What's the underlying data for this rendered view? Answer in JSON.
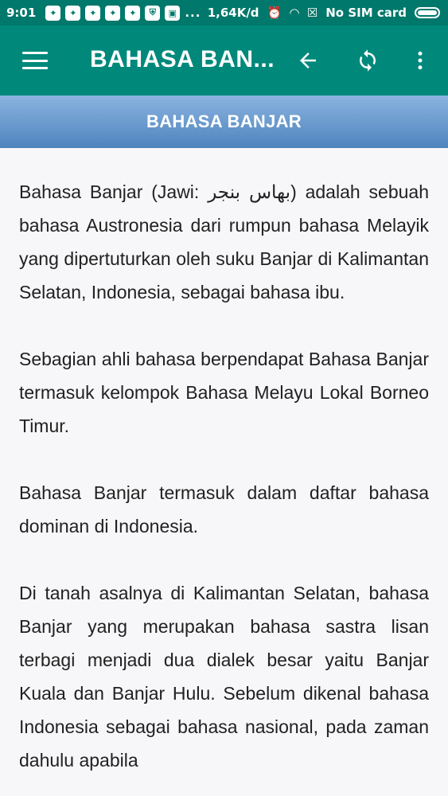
{
  "status_bar": {
    "time": "9:01",
    "network_speed": "1,64K/d",
    "sim_status": "No SIM card",
    "more_indicator": "..."
  },
  "toolbar": {
    "title": "BAHASA BAN...",
    "color": "#00897b"
  },
  "header": {
    "title": "BAHASA BANJAR"
  },
  "article": {
    "paragraphs": [
      "Bahasa Banjar (Jawi: بهاس بنجر) adalah sebuah bahasa Austronesia dari rumpun bahasa Melayik yang dipertuturkan oleh suku Banjar di Kalimantan Selatan, Indonesia, sebagai bahasa ibu.",
      "Sebagian ahli bahasa berpendapat Bahasa Banjar termasuk kelompok Bahasa Melayu Lokal Borneo Timur.",
      "Bahasa Banjar termasuk dalam daftar bahasa dominan di Indonesia.",
      "Di tanah asalnya di Kalimantan Selatan, bahasa Banjar yang merupakan bahasa sastra lisan terbagi menjadi dua dialek besar yaitu Banjar Kuala dan Banjar Hulu. Sebelum dikenal bahasa Indonesia sebagai bahasa nasional, pada zaman dahulu apabila"
    ]
  },
  "icons": {
    "menu": "menu-icon",
    "back": "arrow-back-icon",
    "refresh": "refresh-icon",
    "more": "more-vert-icon"
  }
}
